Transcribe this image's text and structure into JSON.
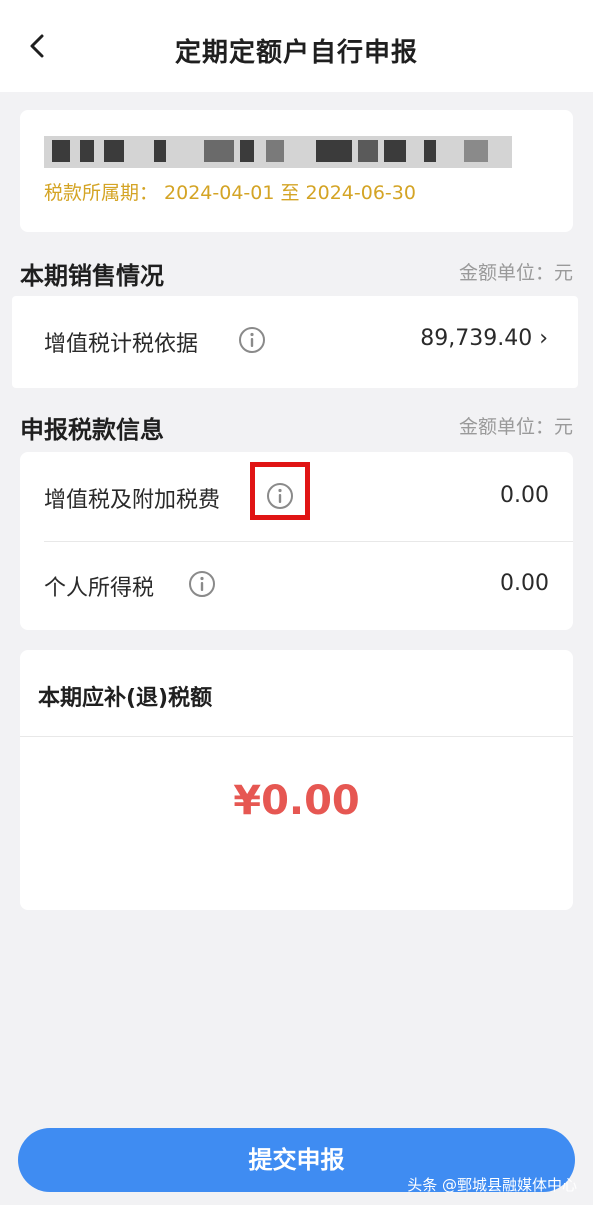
{
  "header": {
    "title": "定期定额户自行申报"
  },
  "taxpayer": {
    "tax_period": "税款所属期： 2024-04-01 至 2024-06-30"
  },
  "sales_section": {
    "title": "本期销售情况",
    "unit": "金额单位：元",
    "basis_label": "增值税计税依据",
    "basis_value": "89,739.40",
    "chevron": "›"
  },
  "declaration_section": {
    "title": "申报税款信息",
    "unit": "金额单位：元",
    "items": [
      {
        "label": "增值税及附加税费",
        "value": "0.00"
      },
      {
        "label": "个人所得税",
        "value": "0.00"
      }
    ]
  },
  "due": {
    "title": "本期应补(退)税额",
    "amount": "¥0.00"
  },
  "footer": {
    "submit_label": "提交申报",
    "watermark": "头条 @鄄城县融媒体中心"
  },
  "colors": {
    "accent": "#3f8cf2",
    "period_text": "#d4a425",
    "amount_red": "#e65752",
    "highlight_box": "#e01414"
  }
}
